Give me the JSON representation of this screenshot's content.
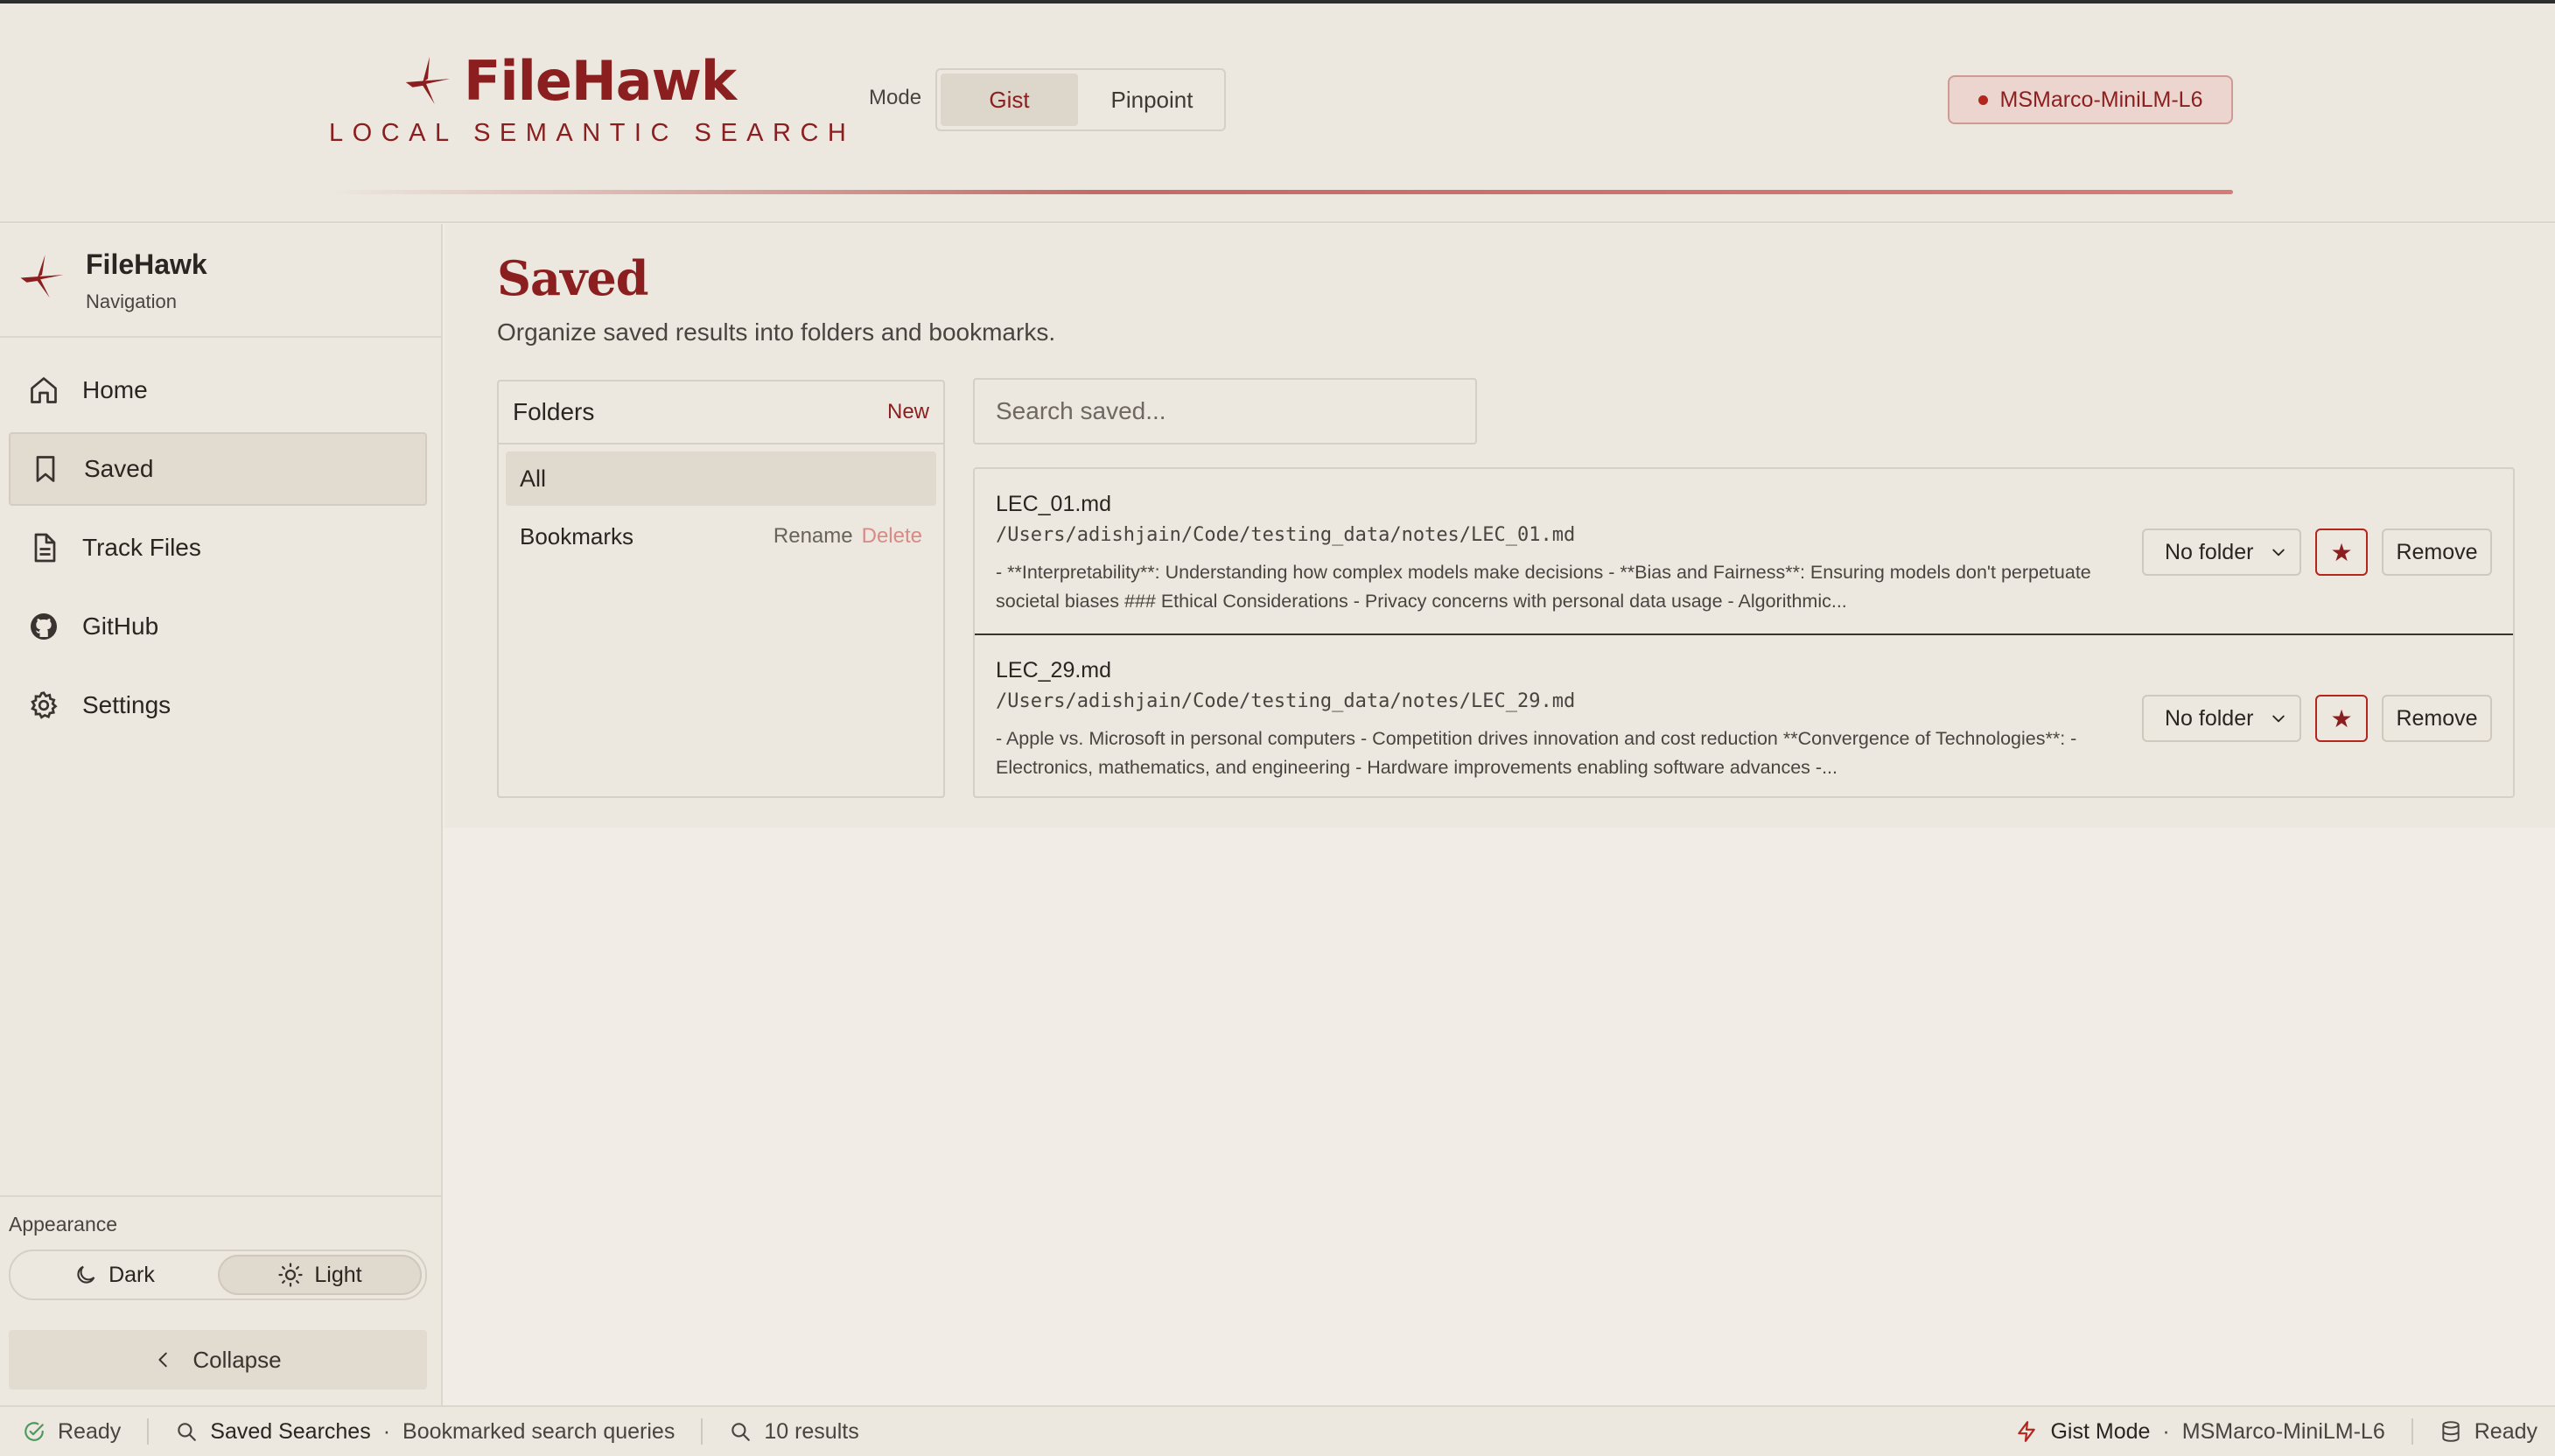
{
  "header": {
    "brand_name": "FileHawk",
    "tagline": "LOCAL SEMANTIC SEARCH",
    "mode_label": "Mode",
    "modes": [
      "Gist",
      "Pinpoint"
    ],
    "active_mode": "Gist",
    "model_name": "MSMarco-MiniLM-L6"
  },
  "sidebar": {
    "title": "FileHawk",
    "subtitle": "Navigation",
    "items": [
      {
        "label": "Home",
        "icon": "home-icon"
      },
      {
        "label": "Saved",
        "icon": "bookmark-icon",
        "active": true
      },
      {
        "label": "Track Files",
        "icon": "file-icon"
      },
      {
        "label": "GitHub",
        "icon": "github-icon"
      },
      {
        "label": "Settings",
        "icon": "gear-icon"
      }
    ],
    "appearance_label": "Appearance",
    "theme_dark": "Dark",
    "theme_light": "Light",
    "active_theme": "Light",
    "collapse_label": "Collapse"
  },
  "main": {
    "title": "Saved",
    "subtitle": "Organize saved results into folders and bookmarks.",
    "folders": {
      "title": "Folders",
      "new_label": "New",
      "all_label": "All",
      "items": [
        {
          "name": "Bookmarks",
          "rename": "Rename",
          "delete": "Delete"
        }
      ]
    },
    "search": {
      "placeholder": "Search saved..."
    },
    "results": [
      {
        "name": "LEC_01.md",
        "path": "/Users/adishjain/Code/testing_data/notes/LEC_01.md",
        "snippet": "- **Interpretability**: Understanding how complex models make decisions - **Bias and Fairness**: Ensuring models don't perpetuate societal biases ### Ethical Considerations - Privacy concerns with personal data usage - Algorithmic...",
        "folder": "No folder",
        "star": "★",
        "remove": "Remove"
      },
      {
        "name": "LEC_29.md",
        "path": "/Users/adishjain/Code/testing_data/notes/LEC_29.md",
        "snippet": "- Apple vs. Microsoft in personal computers - Competition drives innovation and cost reduction **Convergence of Technologies**: - Electronics, mathematics, and engineering - Hardware improvements enabling software advances -...",
        "folder": "No folder",
        "star": "★",
        "remove": "Remove"
      }
    ]
  },
  "statusbar": {
    "ready_left": "Ready",
    "saved_searches": "Saved Searches",
    "bookmarked": "Bookmarked search queries",
    "results_count": "10 results",
    "mode": "Gist Mode",
    "model": "MSMarco-MiniLM-L6",
    "ready_right": "Ready"
  },
  "colors": {
    "accent": "#8b1f1f",
    "background": "#ece7df",
    "border": "#d6cfc5"
  }
}
